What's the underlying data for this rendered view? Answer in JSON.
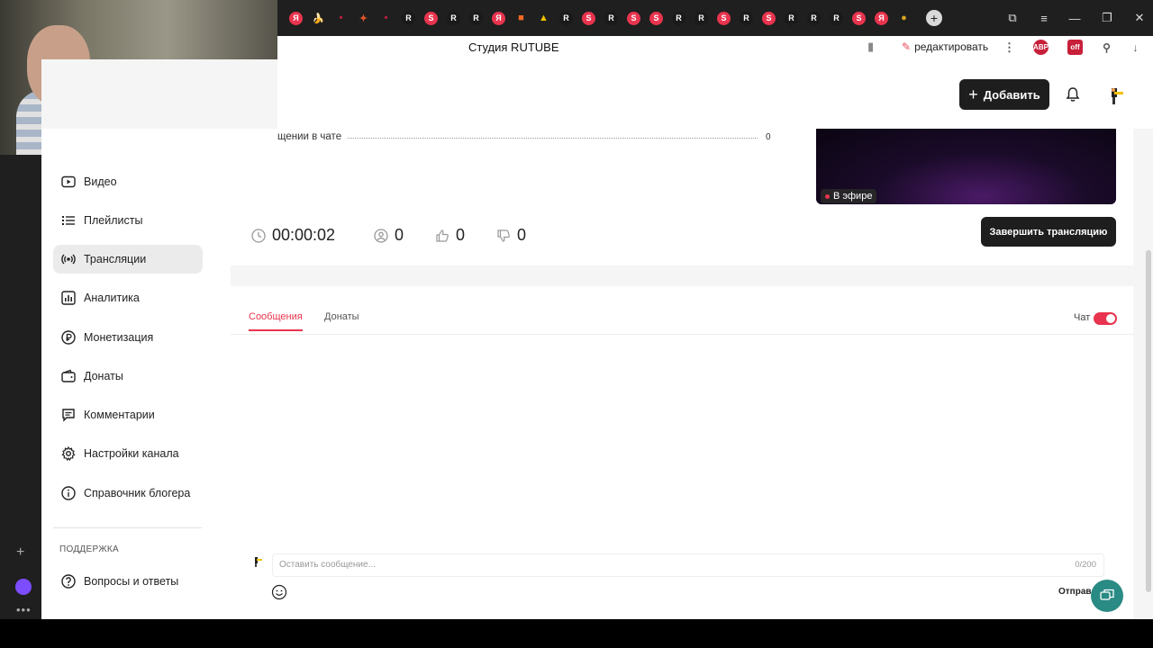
{
  "browser": {
    "tab_favicons": [
      {
        "glyph": "Я",
        "color": "#e8344e"
      },
      {
        "glyph": "🍌",
        "color": "#f2c200"
      },
      {
        "glyph": "•",
        "color": "#c0203a"
      },
      {
        "glyph": "✦",
        "color": "#e2542a"
      },
      {
        "glyph": "•",
        "color": "#c0203a"
      },
      {
        "glyph": "R",
        "color": "#1a1a1a"
      },
      {
        "glyph": "S",
        "color": "#e8344e"
      },
      {
        "glyph": "R",
        "color": "#1a1a1a"
      },
      {
        "glyph": "R",
        "color": "#1a1a1a"
      },
      {
        "glyph": "Я",
        "color": "#e8344e"
      },
      {
        "glyph": "■",
        "color": "#f06a22"
      },
      {
        "glyph": "▲",
        "color": "#f2c200"
      },
      {
        "glyph": "R",
        "color": "#1a1a1a"
      },
      {
        "glyph": "S",
        "color": "#e8344e"
      },
      {
        "glyph": "R",
        "color": "#1a1a1a"
      },
      {
        "glyph": "S",
        "color": "#e8344e"
      },
      {
        "glyph": "S",
        "color": "#e8344e"
      },
      {
        "glyph": "R",
        "color": "#1a1a1a"
      },
      {
        "glyph": "R",
        "color": "#1a1a1a"
      },
      {
        "glyph": "S",
        "color": "#e8344e"
      },
      {
        "glyph": "R",
        "color": "#1a1a1a"
      },
      {
        "glyph": "S",
        "color": "#e8344e"
      },
      {
        "glyph": "R",
        "color": "#1a1a1a"
      },
      {
        "glyph": "R",
        "color": "#1a1a1a"
      },
      {
        "glyph": "R",
        "color": "#1a1a1a"
      },
      {
        "glyph": "S",
        "color": "#e8344e"
      },
      {
        "glyph": "Я",
        "color": "#e8344e"
      },
      {
        "glyph": "●",
        "color": "#d9a520"
      }
    ],
    "page_title": "Студия RUTUBE",
    "edit_label": "редактировать",
    "bookmark_icon": "bookmark-icon"
  },
  "header": {
    "add_button": "Добавить",
    "bell_icon": "bell-icon"
  },
  "sidebar": {
    "items": [
      {
        "label": "Видео",
        "icon": "video-icon"
      },
      {
        "label": "Плейлисты",
        "icon": "playlist-icon"
      },
      {
        "label": "Трансляции",
        "icon": "broadcast-icon",
        "active": true
      },
      {
        "label": "Аналитика",
        "icon": "analytics-icon"
      },
      {
        "label": "Монетизация",
        "icon": "ruble-icon"
      },
      {
        "label": "Донаты",
        "icon": "wallet-icon"
      },
      {
        "label": "Комментарии",
        "icon": "comment-icon"
      },
      {
        "label": "Настройки канала",
        "icon": "gear-icon"
      },
      {
        "label": "Справочник блогера",
        "icon": "info-icon"
      }
    ],
    "section_title": "ПОДДЕРЖКА",
    "support_items": [
      {
        "label": "Вопросы и ответы",
        "icon": "help-circle-icon"
      }
    ]
  },
  "stream": {
    "chat_messages_label": "щении в чате",
    "chat_messages_value": "0",
    "live_label": "В эфире",
    "timer": "00:00:02",
    "viewers": "0",
    "likes": "0",
    "dislikes": "0",
    "end_button": "Завершить трансляцию"
  },
  "chat": {
    "tabs": [
      {
        "label": "Сообщения",
        "active": true
      },
      {
        "label": "Донаты",
        "active": false
      }
    ],
    "chat_toggle_label": "Чат",
    "chat_enabled": true,
    "input_placeholder": "Оставить сообщение...",
    "char_counter": "0/200",
    "send_label": "Отправ"
  },
  "colors": {
    "accent": "#e8344e",
    "dark_button": "#1e1e1e",
    "help_fab": "#2a8a84"
  }
}
